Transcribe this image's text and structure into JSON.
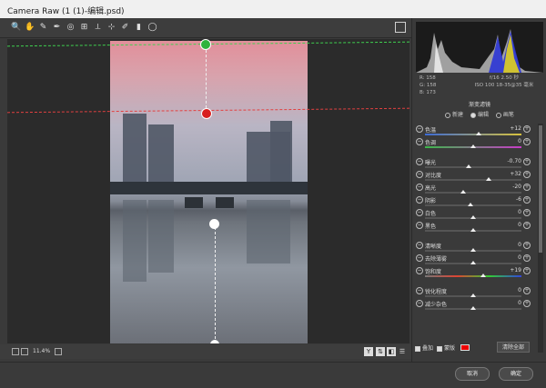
{
  "window": {
    "title": "Camera Raw (1 (1)-编辑.psd)"
  },
  "toolbar": {
    "tools": [
      {
        "icon": "zoom-icon",
        "glyph": "🔍"
      },
      {
        "icon": "hand-icon",
        "glyph": "✋"
      },
      {
        "icon": "white-balance-icon",
        "glyph": "✎"
      },
      {
        "icon": "color-sampler-icon",
        "glyph": "✒"
      },
      {
        "icon": "target-adjust-icon",
        "glyph": "◎"
      },
      {
        "icon": "crop-icon",
        "glyph": "⊞"
      },
      {
        "icon": "straighten-icon",
        "glyph": "⟂"
      },
      {
        "icon": "spot-removal-icon",
        "glyph": "⊹"
      },
      {
        "icon": "brush-icon",
        "glyph": "✐"
      },
      {
        "icon": "graduated-filter-icon",
        "glyph": "▮"
      },
      {
        "icon": "radial-filter-icon",
        "glyph": "◯"
      }
    ]
  },
  "status": {
    "zoom": "11.4%"
  },
  "info": {
    "r": "R: 158",
    "g": "G: 158",
    "b": "B: 173",
    "exposure": "f/16  2.50 秒",
    "iso": "ISO 100  18-35@35 毫米"
  },
  "panel": {
    "title": "渐变滤镜",
    "modes": [
      "新建",
      "编辑",
      "画笔"
    ],
    "active_mode": "编辑"
  },
  "sliders": [
    {
      "label": "色温",
      "value": "+12",
      "pos": 0.56
    },
    {
      "label": "色调",
      "value": "0",
      "pos": 0.5
    },
    {
      "label": "曝光",
      "value": "-0.70",
      "pos": 0.45
    },
    {
      "label": "对比度",
      "value": "+32",
      "pos": 0.66
    },
    {
      "label": "高光",
      "value": "-20",
      "pos": 0.4
    },
    {
      "label": "阴影",
      "value": "-6",
      "pos": 0.47
    },
    {
      "label": "白色",
      "value": "0",
      "pos": 0.5
    },
    {
      "label": "黑色",
      "value": "0",
      "pos": 0.5
    },
    {
      "label": "清晰度",
      "value": "0",
      "pos": 0.5
    },
    {
      "label": "去除薄雾",
      "value": "0",
      "pos": 0.5
    },
    {
      "label": "饱和度",
      "value": "+19",
      "pos": 0.6
    },
    {
      "label": "锐化程度",
      "value": "0",
      "pos": 0.5
    },
    {
      "label": "减少杂色",
      "value": "0",
      "pos": 0.5
    }
  ],
  "mask": {
    "overlay": "叠加",
    "mask": "蒙版",
    "clear_all": "清除全部",
    "color": "#ff0000"
  },
  "footer": {
    "cancel": "取消",
    "ok": "确定"
  }
}
